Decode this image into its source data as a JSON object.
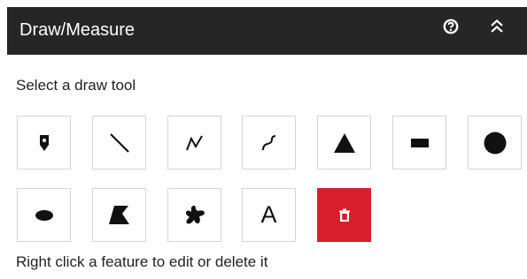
{
  "header": {
    "title": "Draw/Measure",
    "background": "#262626",
    "icons": [
      "help-icon",
      "double-chevron-up-icon"
    ]
  },
  "instruction": "Select a draw tool",
  "tools": [
    {
      "id": "point",
      "icon": "point-marker-icon"
    },
    {
      "id": "line",
      "icon": "line-icon"
    },
    {
      "id": "polyline",
      "icon": "polyline-icon"
    },
    {
      "id": "freehand-polyline",
      "icon": "freehand-polyline-icon"
    },
    {
      "id": "triangle",
      "icon": "triangle-icon"
    },
    {
      "id": "rectangle",
      "icon": "rectangle-icon"
    },
    {
      "id": "circle",
      "icon": "circle-icon"
    },
    {
      "id": "ellipse",
      "icon": "ellipse-icon"
    },
    {
      "id": "polygon",
      "icon": "polygon-icon"
    },
    {
      "id": "freehand-polygon",
      "icon": "freehand-polygon-icon"
    },
    {
      "id": "text",
      "icon": "text-icon",
      "label": "A"
    },
    {
      "id": "clear",
      "icon": "trash-icon",
      "color": "#d81e2b"
    }
  ],
  "footer": "Right click a feature to edit or delete it"
}
